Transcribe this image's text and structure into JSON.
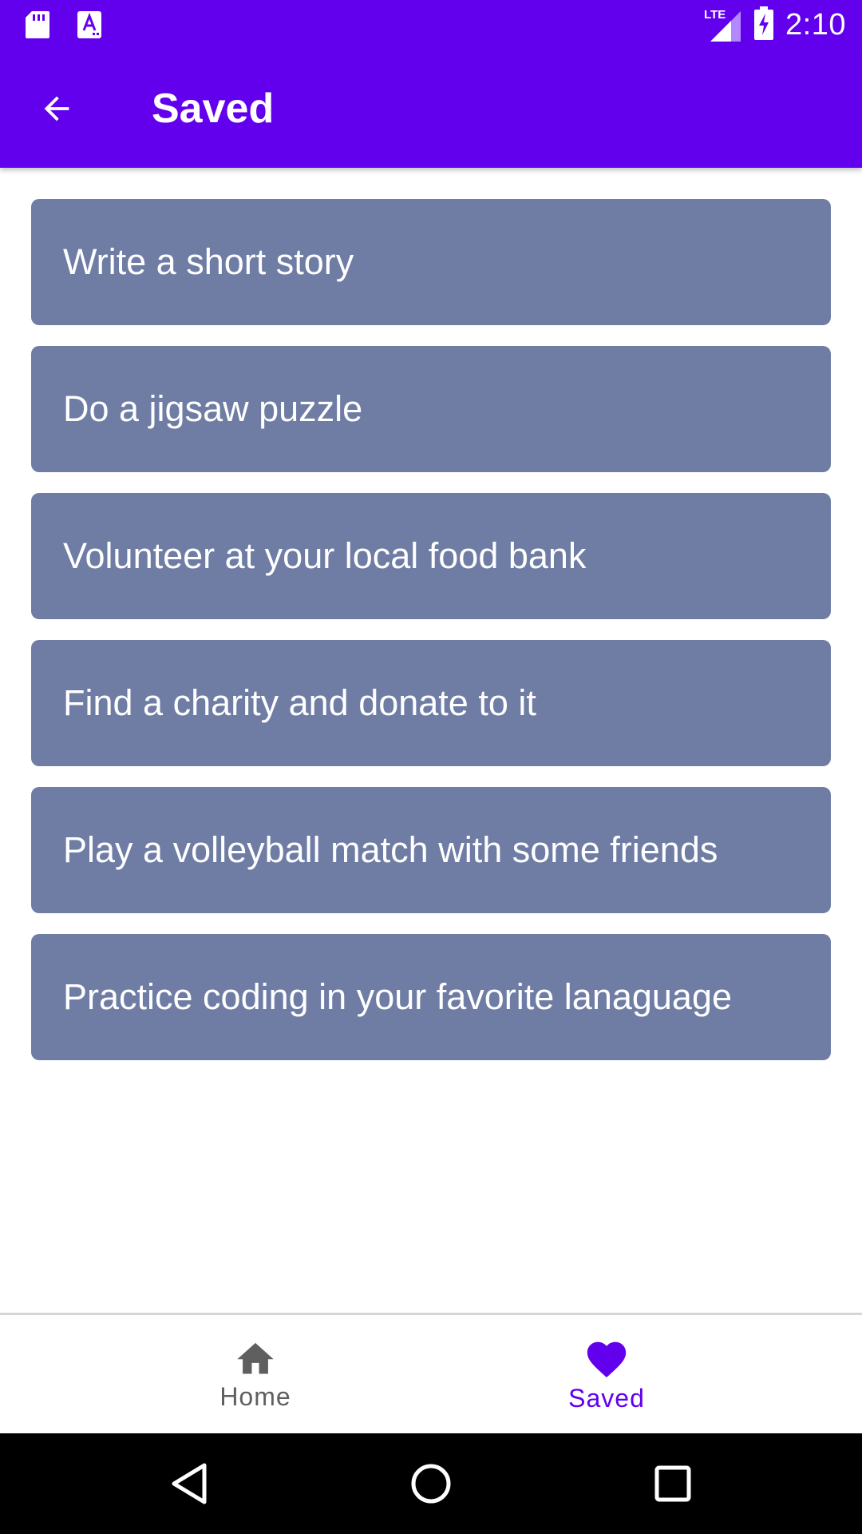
{
  "status_bar": {
    "time": "2:10",
    "network_label": "LTE",
    "left_icons": [
      "sd-card-icon",
      "translate-icon"
    ],
    "right_icons": [
      "signal-lte-icon",
      "battery-charging-icon"
    ]
  },
  "app_bar": {
    "title": "Saved",
    "back_icon": "arrow-back-icon"
  },
  "saved_items": [
    "Write a short story",
    "Do a jigsaw puzzle",
    "Volunteer at your local food bank",
    "Find a charity and donate to it",
    "Play a volleyball match with some friends",
    "Practice coding in your favorite lanaguage"
  ],
  "bottom_nav": {
    "items": [
      {
        "label": "Home",
        "icon": "home-icon",
        "selected": false
      },
      {
        "label": "Saved",
        "icon": "heart-icon",
        "selected": true
      }
    ]
  },
  "system_nav": {
    "buttons": [
      "back-triangle-icon",
      "home-circle-icon",
      "recents-square-icon"
    ]
  },
  "colors": {
    "primary": "#6200ee",
    "card": "#6f7da5",
    "nav_inactive": "#5f5f5f"
  }
}
